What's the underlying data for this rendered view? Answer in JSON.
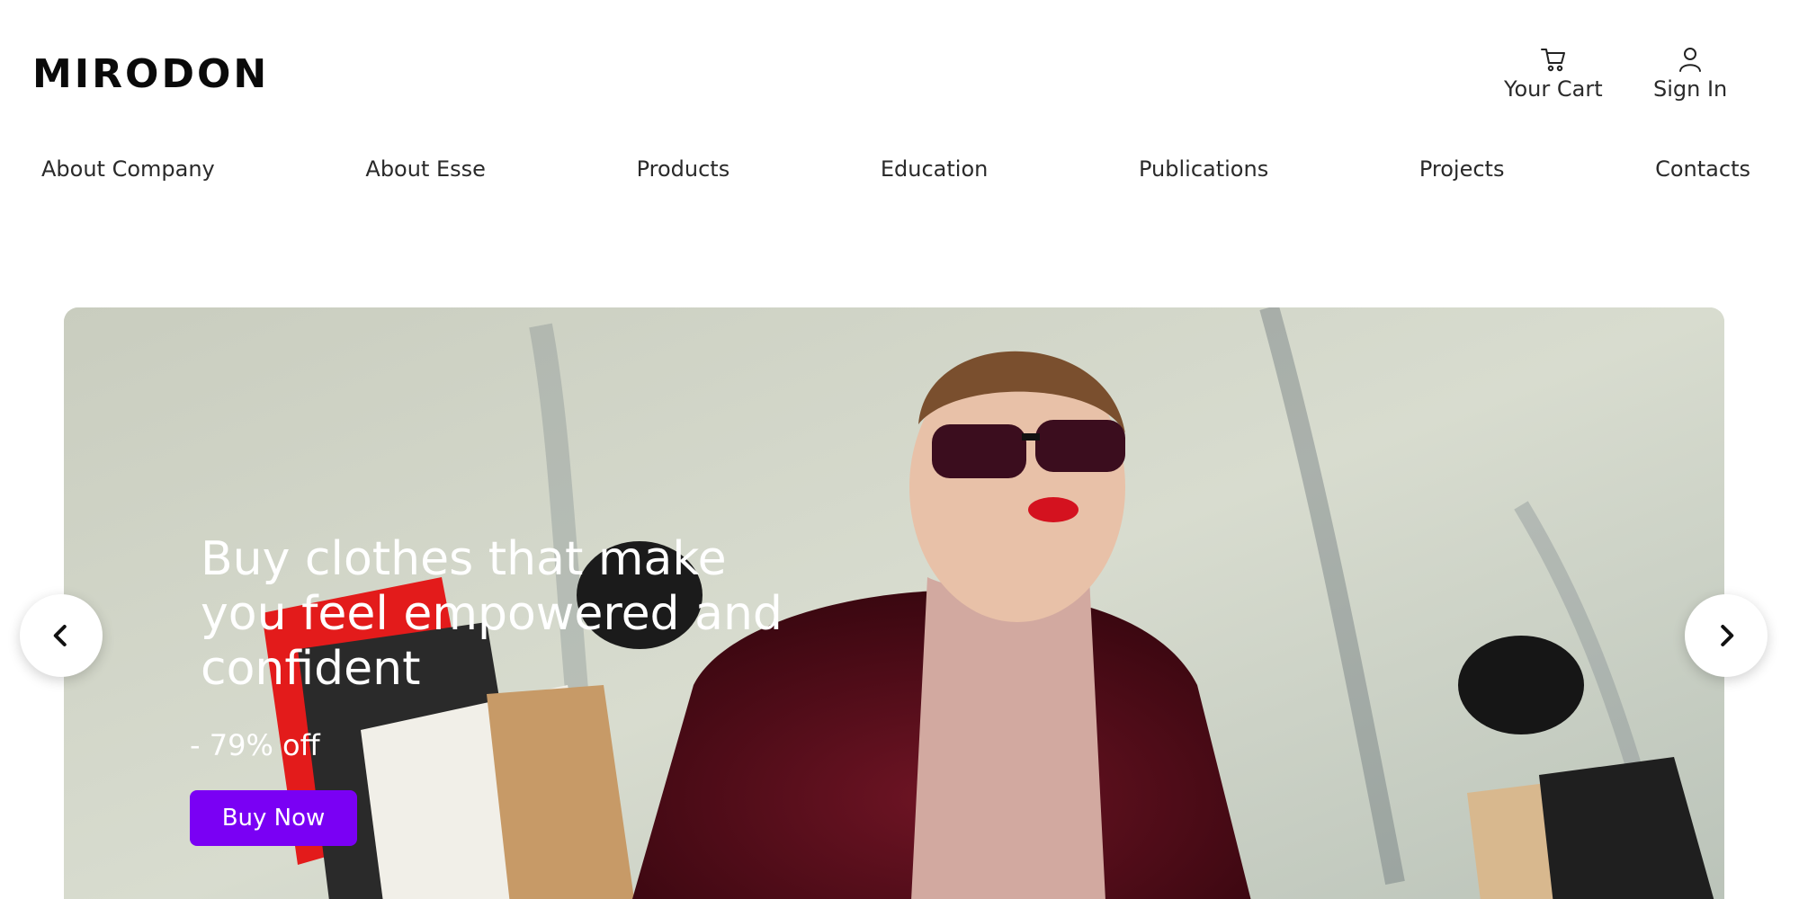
{
  "brand": {
    "logo": "MIRODON"
  },
  "header": {
    "cart": {
      "label": "Your Cart",
      "icon": "cart-icon"
    },
    "signin": {
      "label": "Sign In",
      "icon": "user-icon"
    }
  },
  "nav": {
    "items": [
      {
        "label": "About Company"
      },
      {
        "label": "About Esse"
      },
      {
        "label": "Products"
      },
      {
        "label": "Education"
      },
      {
        "label": "Publications"
      },
      {
        "label": "Projects"
      },
      {
        "label": "Contacts"
      }
    ]
  },
  "hero": {
    "title": "Buy clothes that make you feel empowered and confident",
    "discount": "- 79% off",
    "cta_label": "Buy Now",
    "prev_icon": "chevron-left-icon",
    "next_icon": "chevron-right-icon"
  },
  "colors": {
    "accent": "#7a00f4",
    "text": "#2a2a2a",
    "logo": "#0a0a0a"
  }
}
